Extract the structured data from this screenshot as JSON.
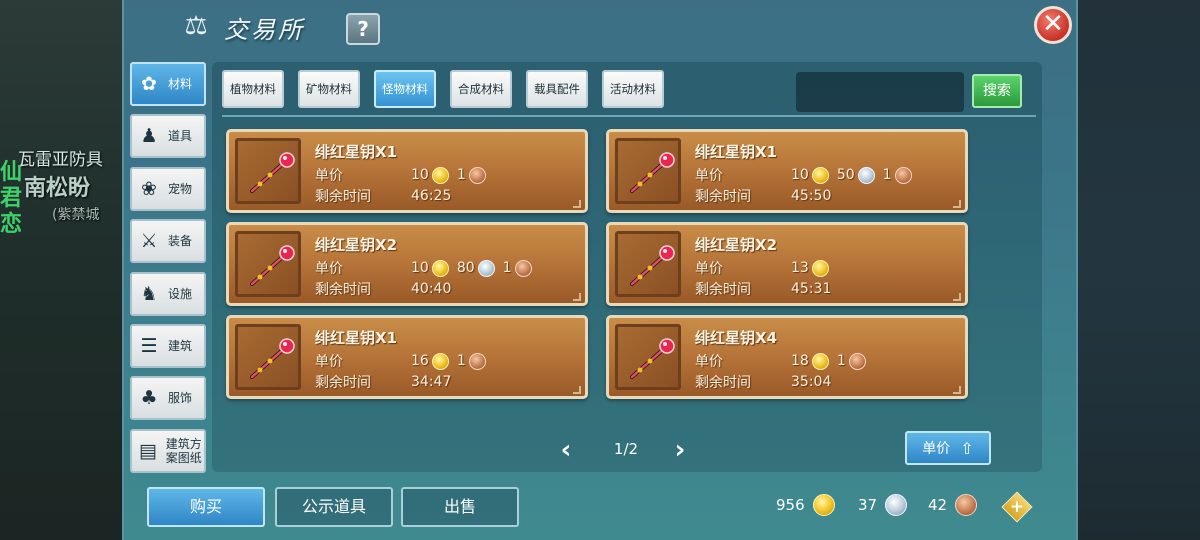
{
  "background": {
    "npc_line1": "瓦雷亚防具",
    "npc_line2": "南松盼",
    "npc_line3": "(紫禁城",
    "side_text": "仙君恋"
  },
  "header": {
    "title": "交易所",
    "help_label": "?",
    "close_label": "✕"
  },
  "sidebar": {
    "items": [
      {
        "label": "材料",
        "icon": "paw-cluster-icon",
        "glyph": "✿",
        "active": true
      },
      {
        "label": "道具",
        "icon": "bell-icon",
        "glyph": "♟",
        "active": false
      },
      {
        "label": "宠物",
        "icon": "pet-paw-icon",
        "glyph": "❀",
        "active": false
      },
      {
        "label": "装备",
        "icon": "equipment-icon",
        "glyph": "⚔",
        "active": false
      },
      {
        "label": "设施",
        "icon": "facility-icon",
        "glyph": "♞",
        "active": false
      },
      {
        "label": "建筑",
        "icon": "building-icon",
        "glyph": "☰",
        "active": false
      },
      {
        "label": "服饰",
        "icon": "clothing-icon",
        "glyph": "♣",
        "active": false
      },
      {
        "label": "建筑方案图纸",
        "icon": "blueprint-icon",
        "glyph": "▤",
        "active": false
      }
    ]
  },
  "tabs": [
    {
      "label": "植物材料",
      "active": false
    },
    {
      "label": "矿物材料",
      "active": false
    },
    {
      "label": "怪物材料",
      "active": true
    },
    {
      "label": "合成材料",
      "active": false
    },
    {
      "label": "载具配件",
      "active": false
    },
    {
      "label": "活动材料",
      "active": false
    }
  ],
  "search": {
    "placeholder": "",
    "button_label": "搜索"
  },
  "listings": [
    {
      "name": "绯红星钥X1",
      "price_label": "单价",
      "gold": "10",
      "silver": "",
      "copper": "1",
      "time_label": "剩余时间",
      "time": "46:25"
    },
    {
      "name": "绯红星钥X1",
      "price_label": "单价",
      "gold": "10",
      "silver": "50",
      "copper": "1",
      "time_label": "剩余时间",
      "time": "45:50"
    },
    {
      "name": "绯红星钥X2",
      "price_label": "单价",
      "gold": "10",
      "silver": "80",
      "copper": "1",
      "time_label": "剩余时间",
      "time": "40:40"
    },
    {
      "name": "绯红星钥X2",
      "price_label": "单价",
      "gold": "13",
      "silver": "",
      "copper": "",
      "time_label": "剩余时间",
      "time": "45:31"
    },
    {
      "name": "绯红星钥X1",
      "price_label": "单价",
      "gold": "16",
      "silver": "",
      "copper": "1",
      "time_label": "剩余时间",
      "time": "34:47"
    },
    {
      "name": "绯红星钥X4",
      "price_label": "单价",
      "gold": "18",
      "silver": "",
      "copper": "1",
      "time_label": "剩余时间",
      "time": "35:04"
    }
  ],
  "pagination": {
    "text": "1/2",
    "prev": "‹",
    "next": "›"
  },
  "sort": {
    "label": "单价",
    "arrow": "⇧"
  },
  "bottom": {
    "buy_label": "购买",
    "show_label": "公示道具",
    "sell_label": "出售"
  },
  "wallet": {
    "gold": "956",
    "silver": "37",
    "copper": "42",
    "add_label": "+"
  },
  "colors": {
    "panel": "#3b7488",
    "active_tab": "#3592d2",
    "search_button": "#2b9a3c",
    "card": "#b8763a",
    "close": "#c8322a"
  }
}
